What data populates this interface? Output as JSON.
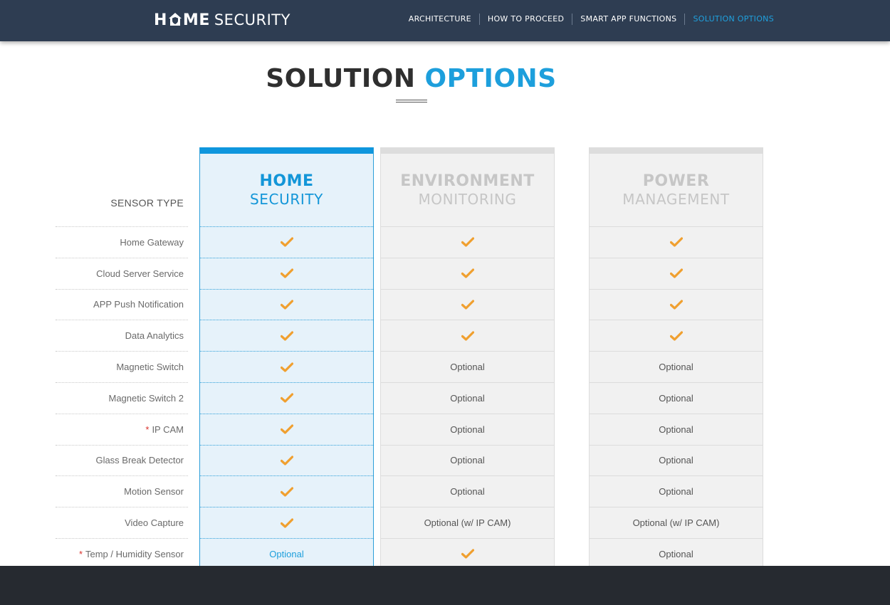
{
  "header": {
    "logo_bold": "H",
    "logo_bold_end": "ME",
    "logo_thin": "SECURITY",
    "nav": [
      {
        "label": "ARCHITECTURE",
        "active": false
      },
      {
        "label": "HOW TO PROCEED",
        "active": false
      },
      {
        "label": "SMART APP FUNCTIONS",
        "active": false
      },
      {
        "label": "SOLUTION OPTIONS",
        "active": true
      }
    ]
  },
  "title": {
    "part1": "SOLUTION",
    "part2": "OPTIONS"
  },
  "table": {
    "label_header": "SENSOR TYPE",
    "rows": [
      {
        "label": "Home Gateway",
        "required": false
      },
      {
        "label": "Cloud Server Service",
        "required": false
      },
      {
        "label": "APP Push Notification",
        "required": false
      },
      {
        "label": "Data Analytics",
        "required": false
      },
      {
        "label": "Magnetic Switch",
        "required": false
      },
      {
        "label": "Magnetic Switch 2",
        "required": false
      },
      {
        "label": "IP CAM",
        "required": true
      },
      {
        "label": "Glass Break Detector",
        "required": false
      },
      {
        "label": "Motion Sensor",
        "required": false
      },
      {
        "label": "Video Capture",
        "required": false
      },
      {
        "label": "Temp / Humidity Sensor",
        "required": true
      }
    ],
    "required_mark": "*",
    "plans": [
      {
        "line1": "HOME",
        "line2": "SECURITY",
        "style": "blue",
        "cells": [
          "check",
          "check",
          "check",
          "check",
          "check",
          "check",
          "check",
          "check",
          "check",
          "check",
          "Optional"
        ]
      },
      {
        "line1": "ENVIRONMENT",
        "line2": "MONITORING",
        "style": "grey1",
        "cells": [
          "check",
          "check",
          "check",
          "check",
          "Optional",
          "Optional",
          "Optional",
          "Optional",
          "Optional",
          "Optional (w/ IP CAM)",
          "check"
        ]
      },
      {
        "line1": "POWER",
        "line2": "MANAGEMENT",
        "style": "grey2",
        "cells": [
          "check",
          "check",
          "check",
          "check",
          "Optional",
          "Optional",
          "Optional",
          "Optional",
          "Optional",
          "Optional (w/ IP CAM)",
          "Optional"
        ]
      }
    ]
  },
  "colors": {
    "accent": "#1d9fdc",
    "header_bg": "#2e3d52",
    "check": "#f0a030",
    "footer_bg": "#262a30"
  },
  "icons": {
    "check": "checkmark-icon",
    "house": "house-shield-icon"
  }
}
